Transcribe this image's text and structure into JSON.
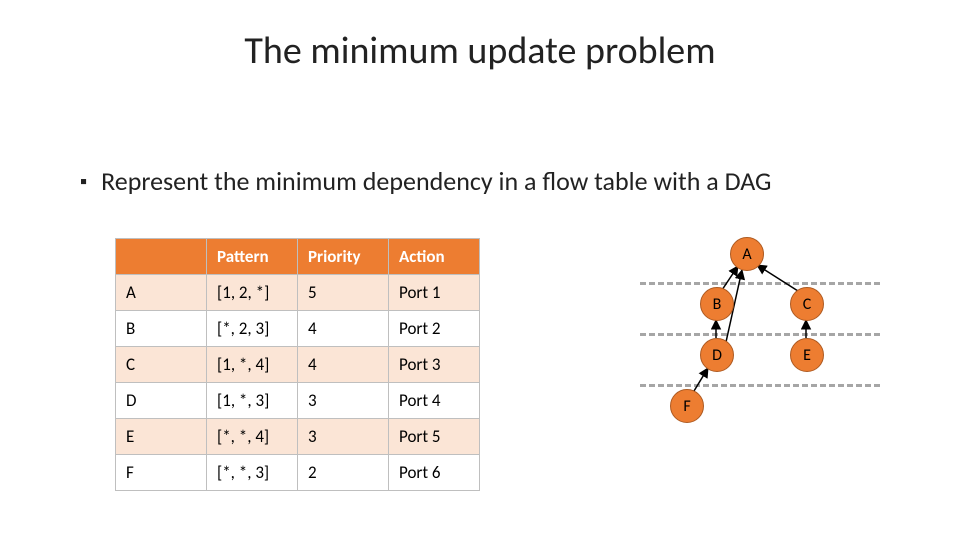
{
  "title": "The minimum update problem",
  "bullet": "Represent the minimum dependency in a flow table with a DAG",
  "table": {
    "headers": {
      "c0": "",
      "c1": "Pattern",
      "c2": "Priority",
      "c3": "Action"
    },
    "rows": [
      {
        "id": "A",
        "pattern": "[1, 2, *]",
        "priority": "5",
        "action": "Port 1"
      },
      {
        "id": "B",
        "pattern": "[*, 2, 3]",
        "priority": "4",
        "action": "Port 2"
      },
      {
        "id": "C",
        "pattern": "[1, *, 4]",
        "priority": "4",
        "action": "Port 3"
      },
      {
        "id": "D",
        "pattern": "[1, *, 3]",
        "priority": "3",
        "action": "Port 4"
      },
      {
        "id": "E",
        "pattern": "[*, *, 4]",
        "priority": "3",
        "action": "Port 5"
      },
      {
        "id": "F",
        "pattern": "[*, *, 3]",
        "priority": "2",
        "action": "Port 6"
      }
    ]
  },
  "dag": {
    "nodes": {
      "A": "A",
      "B": "B",
      "C": "C",
      "D": "D",
      "E": "E",
      "F": "F"
    }
  },
  "chart_data": {
    "type": "dag",
    "nodes": [
      "A",
      "B",
      "C",
      "D",
      "E",
      "F"
    ],
    "levels": {
      "A": 0,
      "B": 1,
      "C": 1,
      "D": 2,
      "E": 2,
      "F": 3
    },
    "edges": [
      [
        "B",
        "A"
      ],
      [
        "C",
        "A"
      ],
      [
        "D",
        "A"
      ],
      [
        "D",
        "B"
      ],
      [
        "E",
        "C"
      ],
      [
        "F",
        "D"
      ]
    ]
  }
}
